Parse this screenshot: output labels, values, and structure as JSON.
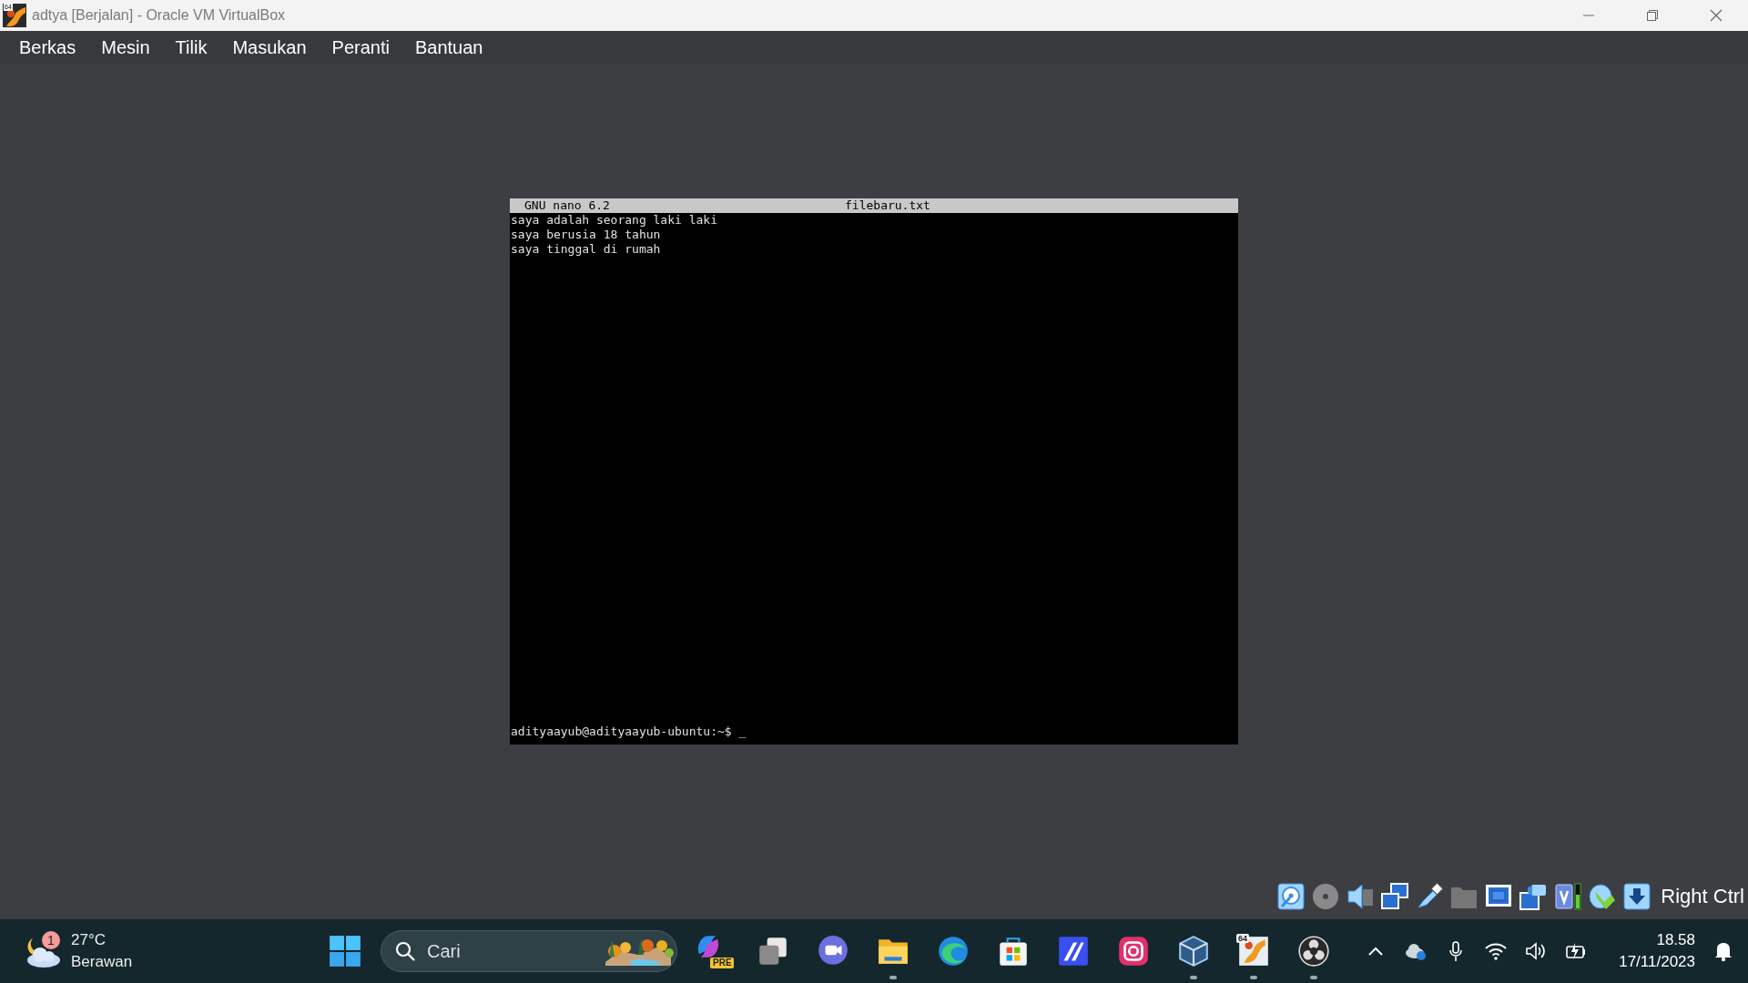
{
  "window": {
    "title": "adtya [Berjalan] - Oracle VM VirtualBox",
    "app_icon_badge": "64"
  },
  "menu": [
    "Berkas",
    "Mesin",
    "Tilik",
    "Masukan",
    "Peranti",
    "Bantuan"
  ],
  "terminal": {
    "header_left": "GNU nano 6.2",
    "header_center": "filebaru.txt",
    "lines": [
      "saya adalah seorang laki laki",
      "saya berusia 18 tahun",
      "saya tinggal di rumah"
    ],
    "prompt": "adityaayub@adityaayub-ubuntu:~$ _"
  },
  "status_bar": {
    "icons": [
      {
        "kind": "hard-disk",
        "active": true
      },
      {
        "kind": "optical",
        "active": false
      },
      {
        "kind": "audio",
        "active": true
      },
      {
        "kind": "network",
        "active": true
      },
      {
        "kind": "usb",
        "active": true
      },
      {
        "kind": "shared-folder",
        "active": false
      },
      {
        "kind": "display",
        "active": true
      },
      {
        "kind": "capture",
        "active": true
      },
      {
        "kind": "cpu",
        "active": true
      },
      {
        "kind": "mouse",
        "active": true
      },
      {
        "kind": "keyboard",
        "active": true
      }
    ],
    "host_key": "Right Ctrl"
  },
  "taskbar": {
    "weather": {
      "temp": "27°C",
      "condition": "Berawan",
      "badge": "1"
    },
    "search": {
      "placeholder": "Cari"
    },
    "apps": [
      {
        "kind": "start",
        "running": false
      },
      {
        "kind": "copilot",
        "badge": "PRE",
        "running": false
      },
      {
        "kind": "task-view",
        "running": false
      },
      {
        "kind": "meet",
        "running": false
      },
      {
        "kind": "explorer",
        "running": true
      },
      {
        "kind": "edge",
        "running": false
      },
      {
        "kind": "store",
        "running": false
      },
      {
        "kind": "ai",
        "running": false
      },
      {
        "kind": "instagram",
        "running": false
      },
      {
        "kind": "virtualbox",
        "running": true
      },
      {
        "kind": "virtualbox64",
        "badge": "64",
        "running": true
      },
      {
        "kind": "obs",
        "running": true
      }
    ],
    "clock": {
      "time": "18.58",
      "date": "17/11/2023"
    }
  }
}
